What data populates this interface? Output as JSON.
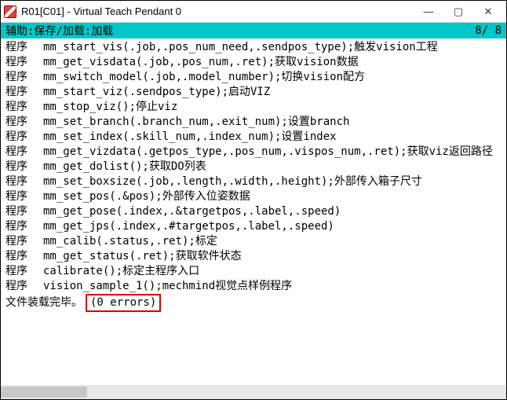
{
  "window": {
    "title": "R01[C01] - Virtual Teach Pendant 0"
  },
  "status": {
    "text": "辅助:保存/加载:加载",
    "counter": "8/ 8"
  },
  "lines": [
    {
      "tag": "程序",
      "code": "mm_start_vis(.job,.pos_num_need,.sendpos_type);触发vision工程"
    },
    {
      "tag": "程序",
      "code": "mm_get_visdata(.job,.pos_num,.ret);获取vision数据"
    },
    {
      "tag": "程序",
      "code": "mm_switch_model(.job,.model_number);切换vision配方"
    },
    {
      "tag": "程序",
      "code": "mm_start_viz(.sendpos_type);启动VIZ"
    },
    {
      "tag": "程序",
      "code": "mm_stop_viz();停止viz"
    },
    {
      "tag": "程序",
      "code": "mm_set_branch(.branch_num,.exit_num);设置branch"
    },
    {
      "tag": "程序",
      "code": "mm_set_index(.skill_num,.index_num);设置index"
    },
    {
      "tag": "程序",
      "code": "mm_get_vizdata(.getpos_type,.pos_num,.vispos_num,.ret);获取viz返回路径"
    },
    {
      "tag": "程序",
      "code": "mm_get_dolist();获取DO列表"
    },
    {
      "tag": "程序",
      "code": "mm_set_boxsize(.job,.length,.width,.height);外部传入箱子尺寸"
    },
    {
      "tag": "程序",
      "code": "mm_set_pos(.&pos);外部传入位姿数据"
    },
    {
      "tag": "程序",
      "code": "mm_get_pose(.index,.&targetpos,.label,.speed)"
    },
    {
      "tag": "程序",
      "code": "mm_get_jps(.index,.#targetpos,.label,.speed)"
    },
    {
      "tag": "程序",
      "code": "mm_calib(.status,.ret);标定"
    },
    {
      "tag": "程序",
      "code": "mm_get_status(.ret);获取软件状态"
    },
    {
      "tag": "程序",
      "code": "calibrate();标定主程序入口"
    },
    {
      "tag": "程序",
      "code": "vision_sample_1();mechmind视觉点样例程序"
    }
  ],
  "footer": {
    "loaded": "文件装载完毕。",
    "errors": "(0 errors)"
  }
}
